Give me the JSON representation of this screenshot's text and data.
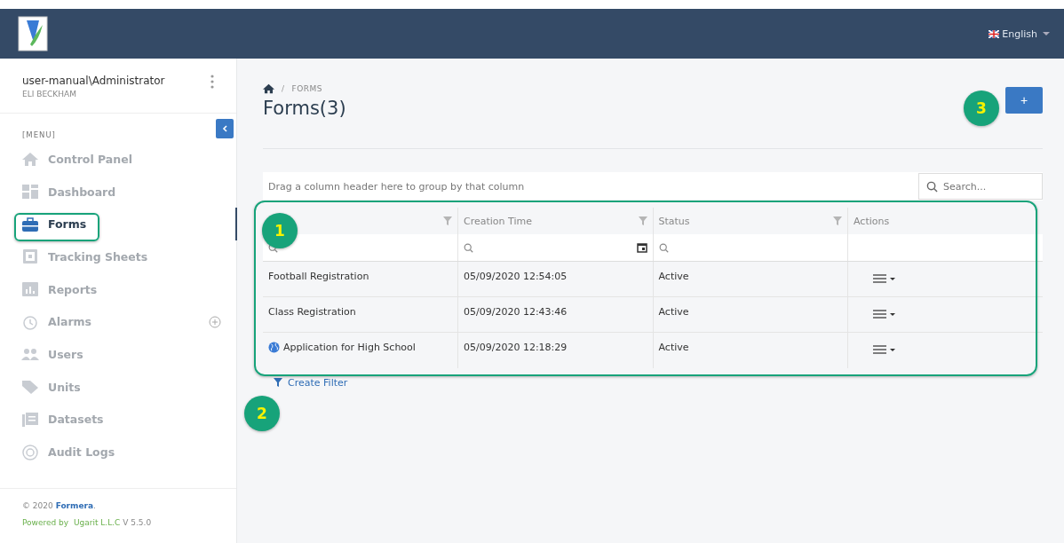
{
  "header": {
    "language": "English"
  },
  "user": {
    "account": "user-manual\\Administrator",
    "name": "ELI BECKHAM"
  },
  "sidebar": {
    "menu_label": "[MENU]",
    "items": [
      {
        "label": "Control Panel",
        "selected": false,
        "addable": false
      },
      {
        "label": "Dashboard",
        "selected": false,
        "addable": false
      },
      {
        "label": "Forms",
        "selected": true,
        "addable": false
      },
      {
        "label": "Tracking Sheets",
        "selected": false,
        "addable": false
      },
      {
        "label": "Reports",
        "selected": false,
        "addable": false
      },
      {
        "label": "Alarms",
        "selected": false,
        "addable": true
      },
      {
        "label": "Users",
        "selected": false,
        "addable": false
      },
      {
        "label": "Units",
        "selected": false,
        "addable": false
      },
      {
        "label": "Datasets",
        "selected": false,
        "addable": false
      },
      {
        "label": "Audit Logs",
        "selected": false,
        "addable": false
      }
    ],
    "footer": {
      "copyright": "© 2020",
      "brand": "Formera",
      "brand_suffix": ".",
      "powered_by": "Powered by",
      "company": "Ugarit L.L.C",
      "version": "V 5.5.0"
    }
  },
  "breadcrumb_separator": "/",
  "breadcrumb": "FORMS",
  "title": "Forms(3)",
  "add_button": "+",
  "grid": {
    "group_panel": "Drag a column header here to group by that column",
    "search": {
      "placeholder": "Search..."
    },
    "columns": [
      {
        "kind": "text"
      },
      {
        "label": "Creation Time",
        "kind": "date"
      },
      {
        "label": "Status",
        "kind": "text"
      },
      {
        "label": "Actions",
        "kind": "none"
      }
    ],
    "rows": [
      {
        "name": "Football Registration",
        "public": false,
        "created": "05/09/2020 12:54:05",
        "status": "Active"
      },
      {
        "name": "Class Registration",
        "public": false,
        "created": "05/09/2020 12:43:46",
        "status": "Active"
      },
      {
        "name": "Application for High School",
        "public": true,
        "created": "05/09/2020 12:18:29",
        "status": "Active"
      }
    ]
  },
  "create_filter": "Create Filter",
  "callouts": [
    "1",
    "2",
    "3"
  ]
}
